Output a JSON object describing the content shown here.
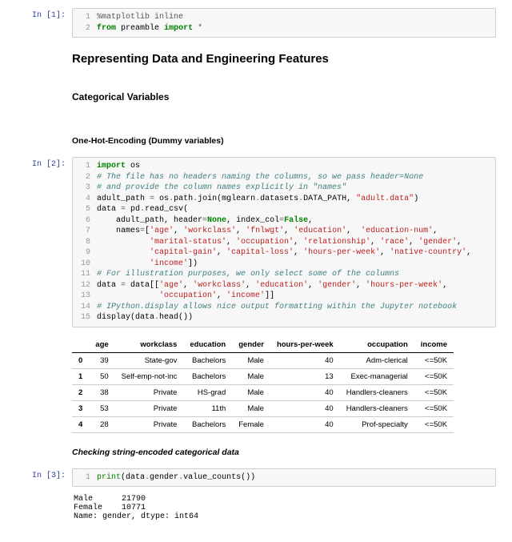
{
  "cells": {
    "c1": {
      "prompt": "In [1]:",
      "lines": [
        {
          "n": "1",
          "html": "<span class='c-magic'>%matplotlib inline</span>"
        },
        {
          "n": "2",
          "html": "<span class='c-kw'>from</span> <span class='c-nm'>preamble</span> <span class='c-kw'>import</span> <span class='c-op'>*</span>"
        }
      ]
    },
    "h1": "Representing Data and Engineering Features",
    "h2": "Categorical Variables",
    "h3": "One-Hot-Encoding (Dummy variables)",
    "c2": {
      "prompt": "In [2]:",
      "lines": [
        {
          "n": "1",
          "html": "<span class='c-kw'>import</span> <span class='c-nm'>os</span>"
        },
        {
          "n": "2",
          "html": "<span class='c-cmt'># The file has no headers naming the columns, so we pass header=None</span>"
        },
        {
          "n": "3",
          "html": "<span class='c-cmt'># and provide the column names explicitly in \"names\"</span>"
        },
        {
          "n": "4",
          "html": "adult_path <span class='c-op'>=</span> os<span class='c-op'>.</span>path<span class='c-op'>.</span>join(mglearn<span class='c-op'>.</span>datasets<span class='c-op'>.</span>DATA_PATH, <span class='c-str'>\"adult.data\"</span>)"
        },
        {
          "n": "5",
          "html": "data <span class='c-op'>=</span> pd<span class='c-op'>.</span>read_csv("
        },
        {
          "n": "6",
          "html": "    adult_path, header<span class='c-op'>=</span><span class='c-bool'>None</span>, index_col<span class='c-op'>=</span><span class='c-bool'>False</span>,"
        },
        {
          "n": "7",
          "html": "    names<span class='c-op'>=</span>[<span class='c-str'>'age'</span>, <span class='c-str'>'workclass'</span>, <span class='c-str'>'fnlwgt'</span>, <span class='c-str'>'education'</span>,  <span class='c-str'>'education-num'</span>,"
        },
        {
          "n": "8",
          "html": "           <span class='c-str'>'marital-status'</span>, <span class='c-str'>'occupation'</span>, <span class='c-str'>'relationship'</span>, <span class='c-str'>'race'</span>, <span class='c-str'>'gender'</span>,"
        },
        {
          "n": "9",
          "html": "           <span class='c-str'>'capital-gain'</span>, <span class='c-str'>'capital-loss'</span>, <span class='c-str'>'hours-per-week'</span>, <span class='c-str'>'native-country'</span>,"
        },
        {
          "n": "10",
          "html": "           <span class='c-str'>'income'</span>])"
        },
        {
          "n": "11",
          "html": "<span class='c-cmt'># For illustration purposes, we only select some of the columns</span>"
        },
        {
          "n": "12",
          "html": "data <span class='c-op'>=</span> data[[<span class='c-str'>'age'</span>, <span class='c-str'>'workclass'</span>, <span class='c-str'>'education'</span>, <span class='c-str'>'gender'</span>, <span class='c-str'>'hours-per-week'</span>,"
        },
        {
          "n": "13",
          "html": "             <span class='c-str'>'occupation'</span>, <span class='c-str'>'income'</span>]]"
        },
        {
          "n": "14",
          "html": "<span class='c-cmt'># IPython.display allows nice output formatting within the Jupyter notebook</span>"
        },
        {
          "n": "15",
          "html": "display(data<span class='c-op'>.</span>head())"
        }
      ]
    },
    "table": {
      "columns": [
        "",
        "age",
        "workclass",
        "education",
        "gender",
        "hours-per-week",
        "occupation",
        "income"
      ],
      "rows": [
        [
          "0",
          "39",
          "State-gov",
          "Bachelors",
          "Male",
          "40",
          "Adm-clerical",
          "<=50K"
        ],
        [
          "1",
          "50",
          "Self-emp-not-inc",
          "Bachelors",
          "Male",
          "13",
          "Exec-managerial",
          "<=50K"
        ],
        [
          "2",
          "38",
          "Private",
          "HS-grad",
          "Male",
          "40",
          "Handlers-cleaners",
          "<=50K"
        ],
        [
          "3",
          "53",
          "Private",
          "11th",
          "Male",
          "40",
          "Handlers-cleaners",
          "<=50K"
        ],
        [
          "4",
          "28",
          "Private",
          "Bachelors",
          "Female",
          "40",
          "Prof-specialty",
          "<=50K"
        ]
      ]
    },
    "h4": "Checking string-encoded categorical data",
    "c3": {
      "prompt": "In [3]:",
      "lines": [
        {
          "n": "1",
          "html": "<span class='c-bi'>print</span>(data<span class='c-op'>.</span>gender<span class='c-op'>.</span>value_counts())"
        }
      ]
    },
    "out3": "Male      21790\nFemale    10771\nName: gender, dtype: int64"
  }
}
